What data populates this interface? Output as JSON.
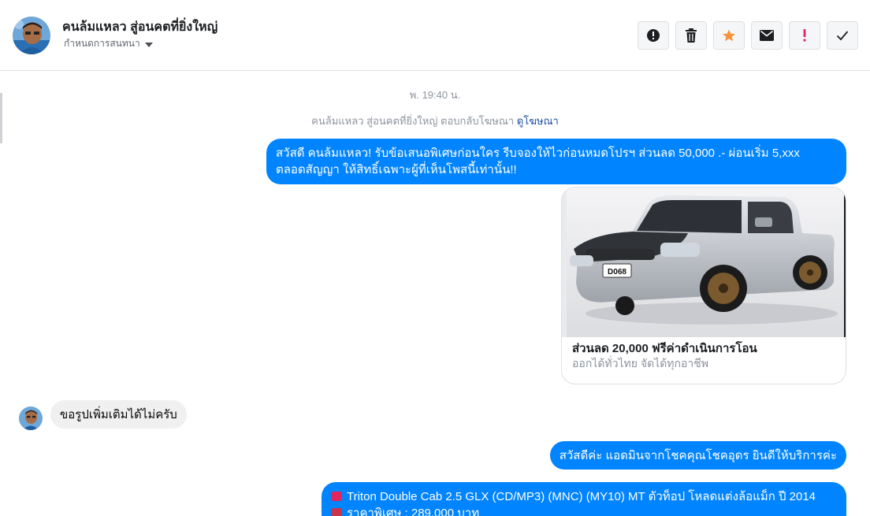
{
  "header": {
    "contact_name": "คนล้มแหลว สู่อนคตที่ยิ่งใหญ่",
    "assign_label": "กำหนดการสนทนา",
    "accent": "#0084ff"
  },
  "actions": [
    {
      "icon": "alert-circle-icon"
    },
    {
      "icon": "trash-icon"
    },
    {
      "icon": "star-icon",
      "color": "#f7923b"
    },
    {
      "icon": "envelope-icon"
    },
    {
      "icon": "exclamation-icon",
      "color": "#e0245e"
    },
    {
      "icon": "checkmark-icon"
    }
  ],
  "conversation": {
    "timestamp": "พ. 19:40 น.",
    "ad_reply": {
      "text": "คนล้มแหลว สู่อนคตที่ยิ่งใหญ่ ตอบกลับโฆษณา",
      "link": "ดูโฆษณา"
    },
    "messages": [
      {
        "from": "page",
        "line1": "สวัสดี คนล้มแหลว! รับข้อเสนอพิเศษก่อนใคร รีบจองให้ไวก่อนหมดโปรฯ ส่วนลด 50,000 .- ผ่อนเริ่ม 5,xxx",
        "line2": "ตลอดสัญญา ให้สิทธิ์เฉพาะผู้ที่เห็นโพสนี้เท่านั้น!!"
      },
      {
        "from": "page",
        "card_title": "ส่วนลด 20,000 ฟรีค่าดำเนินการโอน",
        "card_subtitle": "ออกได้ทั่วไทย จัดได้ทุกอาชีพ",
        "plate": "D068"
      },
      {
        "from": "user",
        "text": "ขอรูปเพิ่มเติมได้ไม่ครับ"
      },
      {
        "from": "page",
        "text": "สวัสดีค่ะ แอดมินจากโชคคุณโชคอุดร ยินดีให้บริการค่ะ"
      },
      {
        "from": "page",
        "line1": "Triton Double Cab 2.5 GLX (CD/MP3) (MNC) (MY10) MT ตัวท็อป โหลดแต่งล้อแม็ก ปี 2014",
        "line2": "ราคาพิเศษ : 289,000 บาท"
      }
    ]
  }
}
